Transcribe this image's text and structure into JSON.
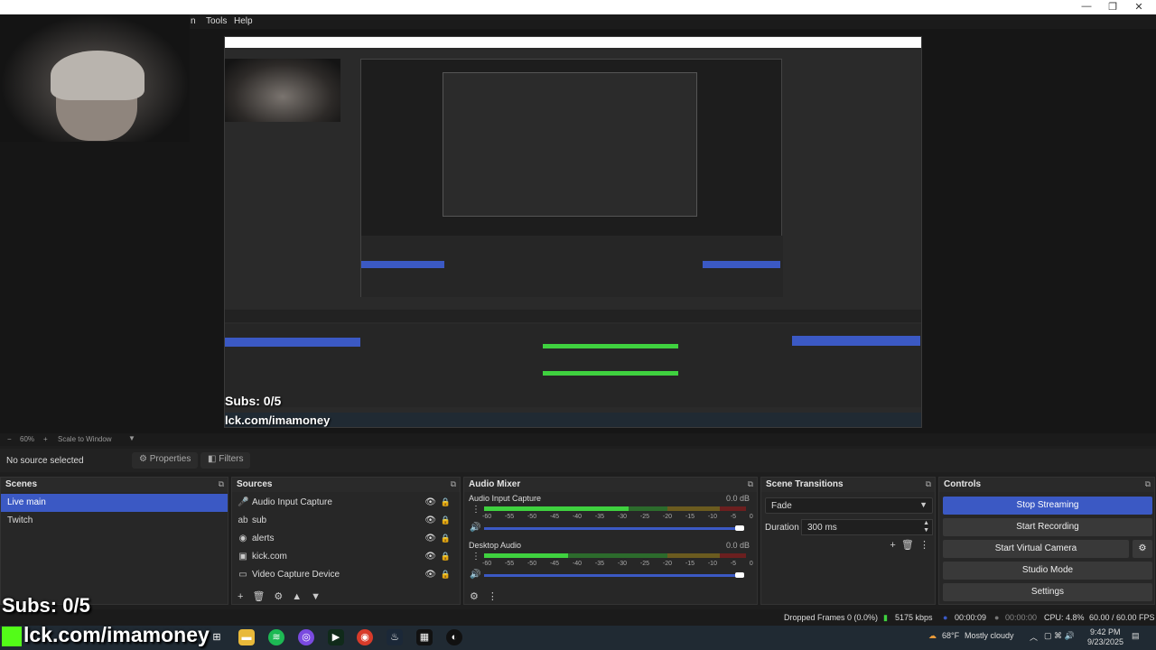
{
  "menu": {
    "items": [
      "n",
      "Tools",
      "Help"
    ]
  },
  "window_controls": [
    "—",
    "❐",
    "✕"
  ],
  "preview": {
    "zoom": "60%",
    "zoom_mode": "Scale to Window",
    "nested_subs": "Subs: 0/5",
    "nested_kick": "lck.com/imamoney"
  },
  "props_bar": {
    "selection": "No source selected",
    "properties": "Properties",
    "filters": "Filters"
  },
  "scenes": {
    "title": "Scenes",
    "items": [
      {
        "label": "Live main",
        "active": true
      },
      {
        "label": "Twitch",
        "active": false
      }
    ]
  },
  "sources": {
    "title": "Sources",
    "items": [
      {
        "label": "Audio Input Capture",
        "icon": "microphone-icon"
      },
      {
        "label": "sub",
        "icon": "text-icon"
      },
      {
        "label": "alerts",
        "icon": "globe-icon"
      },
      {
        "label": "kick.com",
        "icon": "browser-icon"
      },
      {
        "label": "Video Capture Device",
        "icon": "camera-icon"
      }
    ]
  },
  "audio_mixer": {
    "title": "Audio Mixer",
    "channels": [
      {
        "name": "Audio Input Capture",
        "db": "0.0 dB",
        "level": 0.55,
        "volume": 1.0
      },
      {
        "name": "Desktop Audio",
        "db": "0.0 dB",
        "level": 0.32,
        "volume": 1.0
      }
    ],
    "ticks": [
      "-60",
      "-55",
      "-50",
      "-45",
      "-40",
      "-35",
      "-30",
      "-25",
      "-20",
      "-15",
      "-10",
      "-5",
      "0"
    ]
  },
  "transitions": {
    "title": "Scene Transitions",
    "selected": "Fade",
    "duration_label": "Duration",
    "duration_value": "300 ms"
  },
  "controls": {
    "title": "Controls",
    "stop_streaming": "Stop Streaming",
    "start_recording": "Start Recording",
    "start_virtual_camera": "Start Virtual Camera",
    "studio_mode": "Studio Mode",
    "settings": "Settings"
  },
  "status": {
    "dropped_frames": "Dropped Frames 0 (0.0%)",
    "bitrate": "5175 kbps",
    "stream_time": "00:00:09",
    "rec_time": "00:00:00",
    "cpu": "CPU: 4.8%",
    "fps": "60.00 / 60.00 FPS"
  },
  "overlay": {
    "subs": "Subs: 0/5",
    "kick": "lck.com/imamoney"
  },
  "taskbar": {
    "weather": "68°F",
    "weather_desc": "Mostly cloudy",
    "time": "9:42 PM",
    "date": "9/23/2025"
  }
}
